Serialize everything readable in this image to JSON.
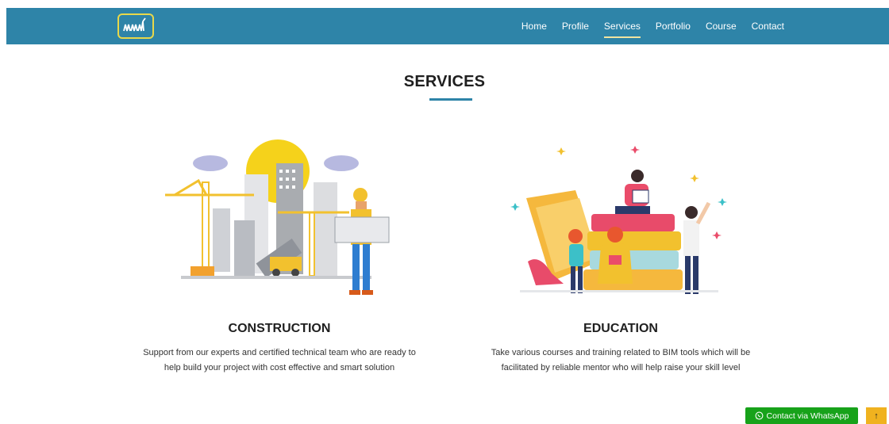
{
  "nav": {
    "logo_text": "ஆம்",
    "items": [
      {
        "label": "Home"
      },
      {
        "label": "Profile"
      },
      {
        "label": "Services"
      },
      {
        "label": "Portfolio"
      },
      {
        "label": "Course"
      },
      {
        "label": "Contact"
      }
    ],
    "active": "Services"
  },
  "page": {
    "title": "SERVICES"
  },
  "services": [
    {
      "title": "CONSTRUCTION",
      "description_line1": "Support from our experts and certified technical team who are ready to",
      "description_line2": "help build your project with cost effective and smart solution"
    },
    {
      "title": "EDUCATION",
      "description_line1": "Take various courses and training related to BIM tools which will be",
      "description_line2": "facilitated by reliable mentor who will help raise your skill level"
    }
  ],
  "floating": {
    "whatsapp_label": "Contact via WhatsApp",
    "whatsapp_icon": "whatsapp-icon",
    "top_icon": "arrow-up-icon"
  },
  "colors": {
    "navbar": "#2e84a8",
    "whatsapp": "#17a21a",
    "top_button": "#f0b21f",
    "accent_yellow": "#f5d21b"
  }
}
